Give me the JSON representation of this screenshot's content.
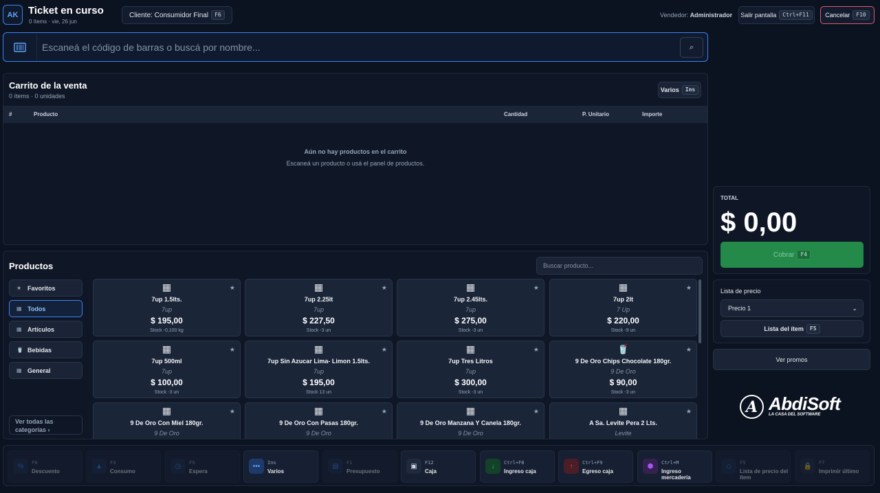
{
  "header": {
    "avatar": "AK",
    "title": "Ticket en curso",
    "subtitle": "0 ítems · vie, 26 jun",
    "client_label": "Cliente: Consumidor Final",
    "client_key": "F6",
    "vendor_prefix": "Vendedor:",
    "vendor_name": "Administrador",
    "exit_label": "Salir pantalla",
    "exit_key": "Ctrl+F11",
    "cancel_label": "Cancelar",
    "cancel_key": "F10"
  },
  "search": {
    "placeholder": "Escaneá el código de barras o buscá por nombre...",
    "go_icon": "⌕"
  },
  "cart": {
    "title": "Carrito de la venta",
    "meta": "0 ítems · 0 unidades",
    "varios_label": "Varios",
    "varios_key": "Ins",
    "columns": [
      "#",
      "Producto",
      "Cantidad",
      "P. Unitario",
      "Importe"
    ],
    "empty_title": "Aún no hay productos en el carrito",
    "empty_sub": "Escaneá un producto o usá el panel de productos."
  },
  "products": {
    "title": "Productos",
    "search_placeholder": "Buscar producto...",
    "categories": [
      {
        "label": "Favoritos",
        "icon": "★",
        "active": false
      },
      {
        "label": "Todos",
        "icon": "▦",
        "active": true
      },
      {
        "label": "Artículos",
        "icon": "▦",
        "active": false
      },
      {
        "label": "Bebidas",
        "icon": "🥤",
        "active": false
      },
      {
        "label": "General",
        "icon": "▦",
        "active": false
      }
    ],
    "all_categories": "Ver todas las categorías ›",
    "items": [
      {
        "name": "7up 1.5lts.",
        "brand": "7up",
        "price": "$ 195,00",
        "stock": "Stock -0,100 kg",
        "icon": "▦"
      },
      {
        "name": "7up 2.25lt",
        "brand": "7up",
        "price": "$ 227,50",
        "stock": "Stock -3 un",
        "icon": "▦"
      },
      {
        "name": "7up 2.45lts.",
        "brand": "7up",
        "price": "$ 275,00",
        "stock": "Stock -3 un",
        "icon": "▦"
      },
      {
        "name": "7up 2lt",
        "brand": "7 Up",
        "price": "$ 220,00",
        "stock": "Stock -9 un",
        "icon": "▦"
      },
      {
        "name": "7up 500ml",
        "brand": "7up",
        "price": "$ 100,00",
        "stock": "Stock -3 un",
        "icon": "▦"
      },
      {
        "name": "7up Sin Azucar Lima- Limon 1.5lts.",
        "brand": "7up",
        "price": "$ 195,00",
        "stock": "Stock 13 un",
        "icon": "▦"
      },
      {
        "name": "7up Tres Litros",
        "brand": "7up",
        "price": "$ 300,00",
        "stock": "Stock -3 un",
        "icon": "▦"
      },
      {
        "name": "9 De Oro Chips Chocolate 180gr.",
        "brand": "9 De Oro",
        "price": "$ 90,00",
        "stock": "Stock -3 un",
        "icon": "🥤"
      },
      {
        "name": "9 De Oro Con Miel 180gr.",
        "brand": "9 De Oro",
        "price": "",
        "stock": "",
        "icon": "▦"
      },
      {
        "name": "9 De Oro Con Pasas 180gr.",
        "brand": "9 De Oro",
        "price": "",
        "stock": "",
        "icon": "▦"
      },
      {
        "name": "9 De Oro Manzana Y Canela 180gr.",
        "brand": "9 De Oro",
        "price": "",
        "stock": "",
        "icon": "▦"
      },
      {
        "name": "A Sa. Levite Pera 2 Lts.",
        "brand": "Levite",
        "price": "",
        "stock": "",
        "icon": "▦"
      }
    ]
  },
  "total": {
    "label": "TOTAL",
    "amount": "$ 0,00",
    "cobrar_label": "Cobrar",
    "cobrar_key": "F4"
  },
  "price_list": {
    "label": "Lista de precio",
    "selected": "Precio 1",
    "item_btn": "Lista del ítem",
    "item_key": "F5"
  },
  "promos_label": "Ver promos",
  "logo": {
    "letter": "A",
    "word": "AbdiSoft",
    "tagline": "LA CASA DEL SOFTWARE"
  },
  "functions": [
    {
      "key": "F8",
      "label": "Descuento",
      "icon": "%",
      "color": "#3b82f6",
      "enabled": false
    },
    {
      "key": "F3",
      "label": "Consumo",
      "icon": "▲",
      "color": "#3b82f6",
      "enabled": false
    },
    {
      "key": "F9",
      "label": "Espera",
      "icon": "◷",
      "color": "#3b82f6",
      "enabled": false
    },
    {
      "key": "Ins",
      "label": "Varios",
      "icon": "•••",
      "color": "#3b82f6",
      "enabled": true
    },
    {
      "key": "F1",
      "label": "Presupuesto",
      "icon": "▤",
      "color": "#3b82f6",
      "enabled": false
    },
    {
      "key": "F12",
      "label": "Caja",
      "icon": "▣",
      "color": "#cbd5e1",
      "enabled": true
    },
    {
      "key": "Ctrl+F8",
      "label": "Ingreso caja",
      "icon": "↓",
      "color": "#22c55e",
      "enabled": true
    },
    {
      "key": "Ctrl+F9",
      "label": "Egreso caja",
      "icon": "↑",
      "color": "#ef4444",
      "enabled": true
    },
    {
      "key": "Ctrl+M",
      "label": "Ingreso mercadería",
      "icon": "⬢",
      "color": "#a855f7",
      "enabled": true
    },
    {
      "key": "F5",
      "label": "Lista de precio del ítem",
      "icon": "◇",
      "color": "#3b82f6",
      "enabled": false
    },
    {
      "key": "F7",
      "label": "Imprimir último",
      "icon": "🔒",
      "color": "#94a3b8",
      "enabled": false
    }
  ],
  "colors": {
    "accent": "#3b82f6",
    "cobrar": "#238a4a",
    "cancel_border": "#e05a6b"
  }
}
